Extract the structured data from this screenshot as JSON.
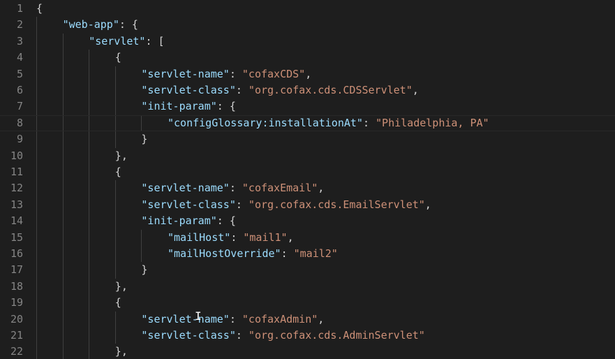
{
  "editor": {
    "language": "json",
    "current_line": 8,
    "colors": {
      "background": "#1e1e1e",
      "line_number": "#858585",
      "property_key": "#9cdcfe",
      "string_value": "#ce9178",
      "punctuation": "#d4d4d4",
      "indent_guide": "#404040"
    },
    "lines": [
      {
        "n": "1",
        "indent": 0,
        "tokens": [
          {
            "t": "{",
            "k": "punc"
          }
        ]
      },
      {
        "n": "2",
        "indent": 1,
        "tokens": [
          {
            "t": "\"web-app\"",
            "k": "key"
          },
          {
            "t": ": {",
            "k": "punc"
          }
        ]
      },
      {
        "n": "3",
        "indent": 2,
        "tokens": [
          {
            "t": "\"servlet\"",
            "k": "key"
          },
          {
            "t": ": [",
            "k": "punc"
          }
        ]
      },
      {
        "n": "4",
        "indent": 3,
        "tokens": [
          {
            "t": "{",
            "k": "punc"
          }
        ]
      },
      {
        "n": "5",
        "indent": 4,
        "tokens": [
          {
            "t": "\"servlet-name\"",
            "k": "key"
          },
          {
            "t": ": ",
            "k": "punc"
          },
          {
            "t": "\"cofaxCDS\"",
            "k": "str"
          },
          {
            "t": ",",
            "k": "punc"
          }
        ]
      },
      {
        "n": "6",
        "indent": 4,
        "tokens": [
          {
            "t": "\"servlet-class\"",
            "k": "key"
          },
          {
            "t": ": ",
            "k": "punc"
          },
          {
            "t": "\"org.cofax.cds.CDSServlet\"",
            "k": "str"
          },
          {
            "t": ",",
            "k": "punc"
          }
        ]
      },
      {
        "n": "7",
        "indent": 4,
        "tokens": [
          {
            "t": "\"init-param\"",
            "k": "key"
          },
          {
            "t": ": {",
            "k": "punc"
          }
        ]
      },
      {
        "n": "8",
        "indent": 5,
        "tokens": [
          {
            "t": "\"configGlossary:installationAt\"",
            "k": "key"
          },
          {
            "t": ": ",
            "k": "punc"
          },
          {
            "t": "\"Philadelphia, PA\"",
            "k": "str"
          }
        ]
      },
      {
        "n": "9",
        "indent": 4,
        "tokens": [
          {
            "t": "}",
            "k": "punc"
          }
        ]
      },
      {
        "n": "10",
        "indent": 3,
        "tokens": [
          {
            "t": "},",
            "k": "punc"
          }
        ]
      },
      {
        "n": "11",
        "indent": 3,
        "tokens": [
          {
            "t": "{",
            "k": "punc"
          }
        ]
      },
      {
        "n": "12",
        "indent": 4,
        "tokens": [
          {
            "t": "\"servlet-name\"",
            "k": "key"
          },
          {
            "t": ": ",
            "k": "punc"
          },
          {
            "t": "\"cofaxEmail\"",
            "k": "str"
          },
          {
            "t": ",",
            "k": "punc"
          }
        ]
      },
      {
        "n": "13",
        "indent": 4,
        "tokens": [
          {
            "t": "\"servlet-class\"",
            "k": "key"
          },
          {
            "t": ": ",
            "k": "punc"
          },
          {
            "t": "\"org.cofax.cds.EmailServlet\"",
            "k": "str"
          },
          {
            "t": ",",
            "k": "punc"
          }
        ]
      },
      {
        "n": "14",
        "indent": 4,
        "tokens": [
          {
            "t": "\"init-param\"",
            "k": "key"
          },
          {
            "t": ": {",
            "k": "punc"
          }
        ]
      },
      {
        "n": "15",
        "indent": 5,
        "tokens": [
          {
            "t": "\"mailHost\"",
            "k": "key"
          },
          {
            "t": ": ",
            "k": "punc"
          },
          {
            "t": "\"mail1\"",
            "k": "str"
          },
          {
            "t": ",",
            "k": "punc"
          }
        ]
      },
      {
        "n": "16",
        "indent": 5,
        "tokens": [
          {
            "t": "\"mailHostOverride\"",
            "k": "key"
          },
          {
            "t": ": ",
            "k": "punc"
          },
          {
            "t": "\"mail2\"",
            "k": "str"
          }
        ]
      },
      {
        "n": "17",
        "indent": 4,
        "tokens": [
          {
            "t": "}",
            "k": "punc"
          }
        ]
      },
      {
        "n": "18",
        "indent": 3,
        "tokens": [
          {
            "t": "},",
            "k": "punc"
          }
        ]
      },
      {
        "n": "19",
        "indent": 3,
        "tokens": [
          {
            "t": "{",
            "k": "punc"
          }
        ]
      },
      {
        "n": "20",
        "indent": 4,
        "tokens": [
          {
            "t": "\"servlet-name\"",
            "k": "key"
          },
          {
            "t": ": ",
            "k": "punc"
          },
          {
            "t": "\"cofaxAdmin\"",
            "k": "str"
          },
          {
            "t": ",",
            "k": "punc"
          }
        ]
      },
      {
        "n": "21",
        "indent": 4,
        "tokens": [
          {
            "t": "\"servlet-class\"",
            "k": "key"
          },
          {
            "t": ": ",
            "k": "punc"
          },
          {
            "t": "\"org.cofax.cds.AdminServlet\"",
            "k": "str"
          }
        ]
      },
      {
        "n": "22",
        "indent": 3,
        "tokens": [
          {
            "t": "},",
            "k": "punc"
          }
        ]
      }
    ],
    "mouse_cursor": {
      "icon": "text-cursor-icon",
      "glyph": "I"
    }
  }
}
